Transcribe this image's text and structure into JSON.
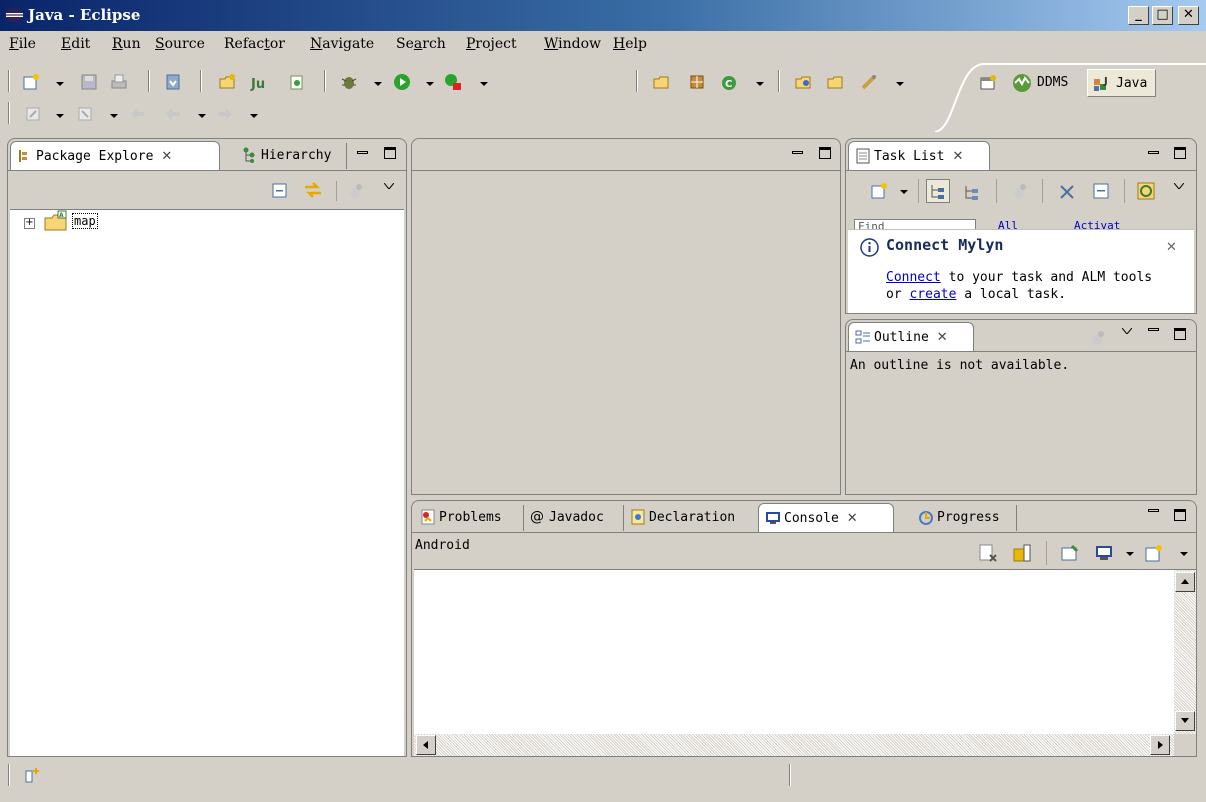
{
  "window": {
    "title": "Java - Eclipse",
    "minimize": "_",
    "maximize": "□",
    "close": "✕"
  },
  "menu": [
    {
      "pre": "",
      "key": "F",
      "post": "ile"
    },
    {
      "pre": "",
      "key": "E",
      "post": "dit"
    },
    {
      "pre": "",
      "key": "R",
      "post": "un"
    },
    {
      "pre": "",
      "key": "S",
      "post": "ource"
    },
    {
      "pre": "Refac",
      "key": "t",
      "post": "or"
    },
    {
      "pre": "",
      "key": "N",
      "post": "avigate"
    },
    {
      "pre": "Se",
      "key": "a",
      "post": "rch"
    },
    {
      "pre": "",
      "key": "P",
      "post": "roject"
    },
    {
      "pre": "",
      "key": "W",
      "post": "indow"
    },
    {
      "pre": "",
      "key": "H",
      "post": "elp"
    }
  ],
  "perspectives": {
    "ddms": "DDMS",
    "java": "Java"
  },
  "package_explorer": {
    "tab_label": "Package Explore",
    "hierarchy_label": "Hierarchy",
    "tree": [
      {
        "label": "map",
        "expander": "+"
      }
    ]
  },
  "task_list": {
    "tab_label": "Task List",
    "filter_placeholder": "Find",
    "filter_links": [
      "All",
      "Activat"
    ],
    "mylyn": {
      "title": "Connect Mylyn",
      "connect_link": "Connect",
      "line1_rest": " to your task and ALM tools",
      "line2_pre": "or ",
      "create_link": "create",
      "line2_rest": " a local task."
    }
  },
  "outline": {
    "tab_label": "Outline",
    "message": "An outline is not available."
  },
  "bottom_panel": {
    "tabs": [
      {
        "label": "Problems",
        "active": false
      },
      {
        "label": "Javadoc",
        "active": false
      },
      {
        "label": "Declaration",
        "active": false
      },
      {
        "label": "Console",
        "active": true
      },
      {
        "label": "Progress",
        "active": false
      }
    ],
    "console_name": "Android"
  },
  "close_glyph": "✕",
  "colors": {
    "window_bg": "#d4d0c8",
    "title_gradient_start": "#0a246a",
    "link": "#0000cc",
    "mylyn_bg": "#ffffff"
  }
}
